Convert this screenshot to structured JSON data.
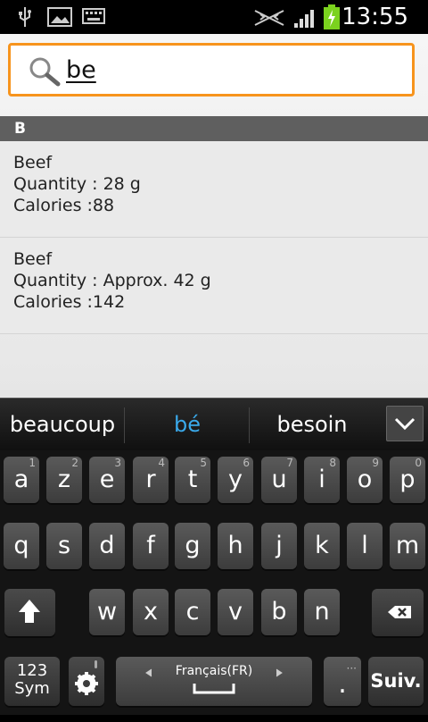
{
  "status_bar": {
    "time": "13:55",
    "icons": [
      "usb-icon",
      "image-icon",
      "keyboard-icon",
      "mute-icon",
      "signal-icon",
      "battery-icon"
    ],
    "battery_color": "#7bd21e"
  },
  "search": {
    "query": "be",
    "accent_color": "#f7941d"
  },
  "results": {
    "section_label": "B",
    "items": [
      {
        "name": "Beef",
        "quantity": "Quantity : 28 g",
        "calories": "Calories :88"
      },
      {
        "name": "Beef",
        "quantity": "Quantity : Approx. 42 g",
        "calories": "Calories :142"
      }
    ]
  },
  "keyboard": {
    "suggestions": [
      "beaucoup",
      "bé",
      "besoin"
    ],
    "suggestion_highlight_color": "#3aa9ea",
    "row1": [
      {
        "k": "a",
        "n": "1"
      },
      {
        "k": "z",
        "n": "2"
      },
      {
        "k": "e",
        "n": "3"
      },
      {
        "k": "r",
        "n": "4"
      },
      {
        "k": "t",
        "n": "5"
      },
      {
        "k": "y",
        "n": "6"
      },
      {
        "k": "u",
        "n": "7"
      },
      {
        "k": "i",
        "n": "8"
      },
      {
        "k": "o",
        "n": "9"
      },
      {
        "k": "p",
        "n": "0"
      }
    ],
    "row2": [
      "q",
      "s",
      "d",
      "f",
      "g",
      "h",
      "j",
      "k",
      "l",
      "m"
    ],
    "row3": [
      "w",
      "x",
      "c",
      "v",
      "b",
      "n"
    ],
    "sym_label_1": "123",
    "sym_label_2": "Sym",
    "space_label": "Français(FR)",
    "period_label": ".",
    "enter_label": "Suiv."
  }
}
